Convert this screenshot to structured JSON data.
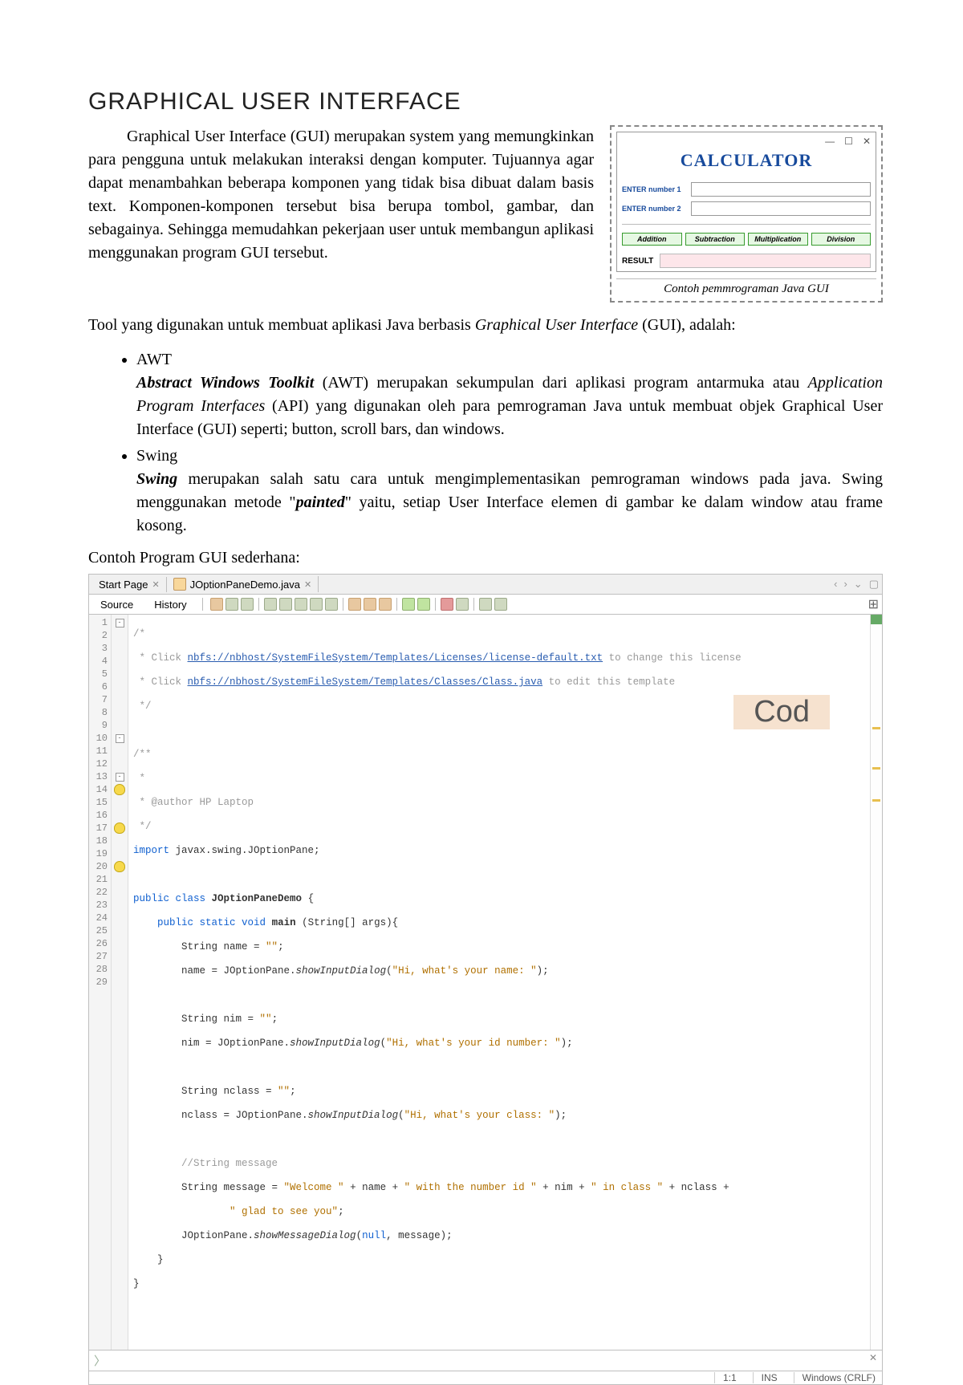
{
  "title": "GRAPHICAL USER INTERFACE",
  "intro": "Graphical User Interface (GUI) merupakan system yang memungkinkan para pengguna untuk melakukan interaksi dengan komputer. Tujuannya agar dapat menambahkan beberapa komponen yang tidak bisa dibuat dalam basis text. Komponen-komponen tersebut bisa berupa tombol, gambar, dan sebagainya. Sehingga memudahkan pekerjaan user untuk membangun aplikasi menggunakan program GUI tersebut.",
  "calc": {
    "title": "CALCULATOR",
    "label_num1": "ENTER number 1",
    "label_num2": "ENTER number 2",
    "btn_add": "Addition",
    "btn_sub": "Subtraction",
    "btn_mul": "Multiplication",
    "btn_div": "Division",
    "result_label": "RESULT",
    "caption": "Contoh pemmrograman Java GUI"
  },
  "tool_text": "Tool yang digunakan untuk membuat aplikasi Java berbasis Graphical User Interface (GUI), adalah:",
  "bullets": {
    "awt_head": "AWT",
    "awt_bold": "Abstract Windows Toolkit",
    "awt_tail1": " (AWT) merupakan sekumpulan dari aplikasi program antarmuka atau ",
    "awt_ital": "Application Program Interfaces",
    "awt_tail2": " (API) yang digunakan oleh para pemrograman Java untuk membuat objek Graphical User Interface (GUI) seperti; button, scroll bars, dan windows.",
    "swing_head": "Swing",
    "swing_bold": "Swing",
    "swing_tail1": " merupakan salah satu cara untuk mengimplementasikan pemrograman windows pada java. Swing menggunakan metode \"",
    "swing_ital": "painted",
    "swing_tail2": "\" yaitu, setiap User Interface elemen di gambar ke dalam window atau frame kosong."
  },
  "example_label": "Contoh Program GUI sederhana:",
  "ide": {
    "tabs": {
      "start": "Start Page",
      "file": "JOptionPaneDemo.java"
    },
    "toolbar": {
      "source": "Source",
      "history": "History"
    },
    "overlay": "Cod",
    "status": {
      "pos": "1:1",
      "ins": "INS",
      "enc": "Windows (CRLF)"
    },
    "code": {
      "l1": "/*",
      "l2a": " * Click ",
      "l2link": "nbfs://nbhost/SystemFileSystem/Templates/Licenses/license-default.txt",
      "l2b": " to change this license",
      "l3a": " * Click ",
      "l3link": "nbfs://nbhost/SystemFileSystem/Templates/Classes/Class.java",
      "l3b": " to edit this template",
      "l4": " */",
      "l6": "/**",
      "l7": " *",
      "l8": " * @author HP Laptop",
      "l9": " */",
      "l10_kw": "import",
      "l10_rest": " javax.swing.JOptionPane;",
      "l12_kw": "public class ",
      "l12_cls": "JOptionPaneDemo",
      "l12_end": " {",
      "l13_kw1": "public static ",
      "l13_kw2": "void ",
      "l13_m": "main",
      "l13_rest": " (String[] args){",
      "l14a": "String name = ",
      "l14s": "\"\"",
      "l14b": ";",
      "l15a": "name = JOptionPane.",
      "l15m": "showInputDialog",
      "l15b": "(",
      "l15s": "\"Hi, what's your name: \"",
      "l15c": ");",
      "l17a": "String nim = ",
      "l17s": "\"\"",
      "l17b": ";",
      "l18a": "nim = JOptionPane.",
      "l18m": "showInputDialog",
      "l18b": "(",
      "l18s": "\"Hi, what's your id number: \"",
      "l18c": ");",
      "l20a": "String nclass = ",
      "l20s": "\"\"",
      "l20b": ";",
      "l21a": "nclass = JOptionPane.",
      "l21m": "showInputDialog",
      "l21b": "(",
      "l21s": "\"Hi, what's your class: \"",
      "l21c": ");",
      "l23": "//String message",
      "l24a": "String message = ",
      "l24s1": "\"Welcome \"",
      "l24b": " + name + ",
      "l24s2": "\" with the number id \"",
      "l24c": " + nim + ",
      "l24s3": "\" in class \"",
      "l24d": " + nclass +",
      "l25s": "\" glad to see you\"",
      "l25b": ";",
      "l26a": "JOptionPane.",
      "l26m": "showMessageDialog",
      "l26b": "(",
      "l26kw": "null",
      "l26c": ", message);",
      "l27": "}",
      "l28": "}"
    }
  }
}
